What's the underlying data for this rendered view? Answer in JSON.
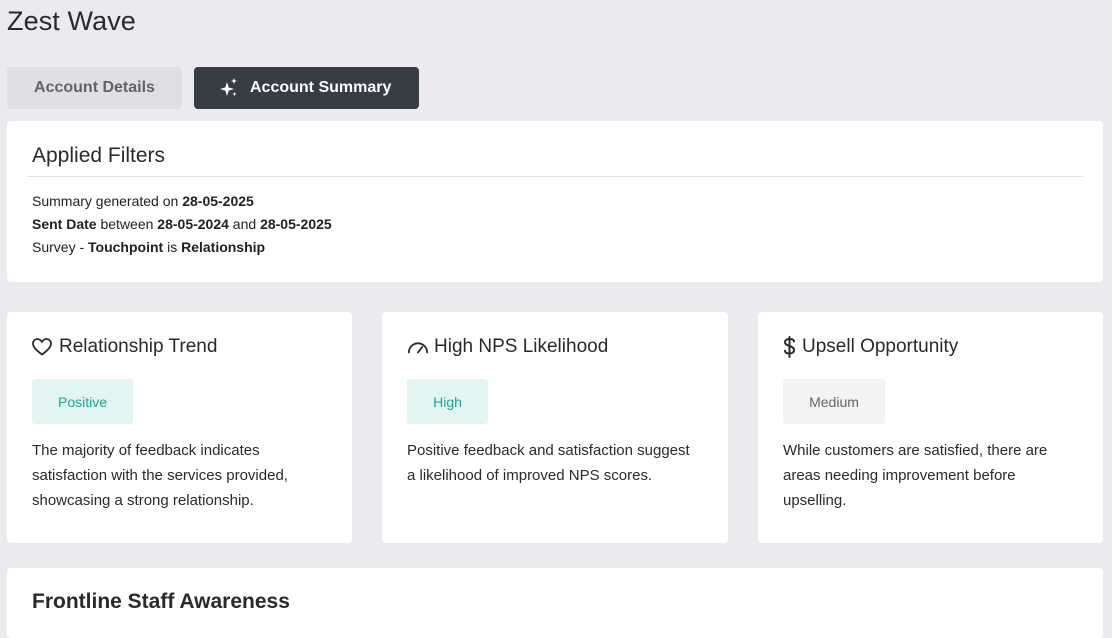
{
  "page": {
    "title": "Zest Wave"
  },
  "tabs": [
    {
      "label": "Account Details",
      "active": false
    },
    {
      "label": "Account Summary",
      "active": true,
      "icon": "sparkle-icon"
    }
  ],
  "filters": {
    "title": "Applied Filters",
    "line1": {
      "prefix": "Summary generated on ",
      "date": "28-05-2025"
    },
    "line2": {
      "field": "Sent Date",
      "between": " between ",
      "start": "28-05-2024",
      "and": " and ",
      "end": "28-05-2025"
    },
    "line3": {
      "prefix": "Survey - ",
      "field": "Touchpoint",
      "is": " is ",
      "value": "Relationship"
    }
  },
  "metrics": [
    {
      "icon": "heart-icon",
      "title": "Relationship Trend",
      "badge": "Positive",
      "description": "The majority of feedback indicates satisfaction with the services provided, showcasing a strong relationship."
    },
    {
      "icon": "gauge-icon",
      "title": "High NPS Likelihood",
      "badge": "High",
      "description": "Positive feedback and satisfaction suggest a likelihood of improved NPS scores."
    },
    {
      "icon": "dollar-icon",
      "title": "Upsell Opportunity",
      "badge": "Medium",
      "description": "While customers are satisfied, there are areas needing improvement before upselling."
    }
  ],
  "frontline": {
    "title": "Frontline Staff Awareness"
  },
  "colors": {
    "background": "#ebebef",
    "active_tab": "#363d45",
    "positive_text": "#1ea58d",
    "positive_bg": "#e3f5f2",
    "neutral_bg": "#f3f3f4"
  }
}
